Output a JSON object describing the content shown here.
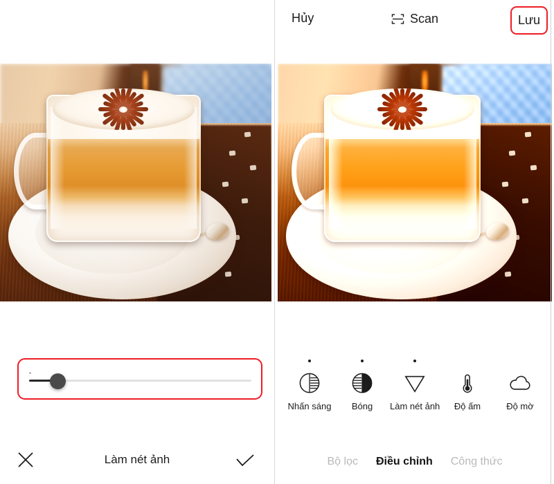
{
  "topbar": {
    "cancel_label": "Hủy",
    "scan_label": "Scan",
    "scan_icon": "scan-document-icon",
    "save_label": "Lưu",
    "save_highlight_color": "#ee1c25"
  },
  "photos": {
    "before": {
      "name": "original-photo",
      "subject": "layered latte in a clear glass mug on a white saucer with spoon, wooden table, blue chair in background"
    },
    "after": {
      "name": "sharpened-photo",
      "subject": "same latte photo with sharpen adjustment applied"
    }
  },
  "left_panel": {
    "slider": {
      "name": "sharpen-slider",
      "value_percent": 13,
      "min_tick": true,
      "highlight_color": "#ee1c25",
      "thumb_color": "#4a4a4a",
      "fill_color": "#262626",
      "rail_color": "#e2e2e2"
    },
    "actions": {
      "cancel_icon": "close-x-icon",
      "title": "Làm nét ảnh",
      "confirm_icon": "check-icon"
    }
  },
  "right_panel": {
    "tools": [
      {
        "label": "Nhấn sáng",
        "icon": "highlights-icon",
        "modified": true
      },
      {
        "label": "Bóng",
        "icon": "shadows-icon",
        "modified": true
      },
      {
        "label": "Làm nét ảnh",
        "icon": "sharpen-triangle-icon",
        "modified": true
      },
      {
        "label": "Độ ấm",
        "icon": "thermometer-icon",
        "modified": false
      },
      {
        "label": "Độ mờ",
        "icon": "cloud-blur-icon",
        "modified": false
      }
    ],
    "tabs": [
      {
        "label": "Bộ lọc",
        "active": false
      },
      {
        "label": "Điều chỉnh",
        "active": true
      },
      {
        "label": "Công thức",
        "active": false
      }
    ]
  }
}
